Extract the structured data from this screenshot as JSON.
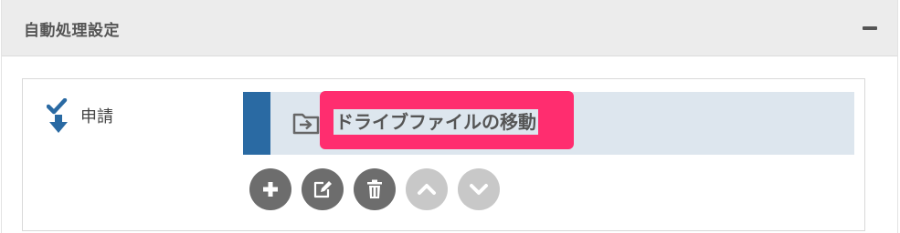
{
  "panel": {
    "title": "自動処理設定",
    "collapse_icon": "minus-icon"
  },
  "step": {
    "label": "申請",
    "icon": "check-down-arrow-icon",
    "icon_color": "#2a6aa3"
  },
  "process": {
    "label": "ドライブファイルの移動",
    "icon": "folder-move-icon",
    "bar_color": "#2a6aa3",
    "highlight_color": "#ff2d6f"
  },
  "actions": [
    {
      "name": "add",
      "icon": "plus-icon",
      "enabled": true
    },
    {
      "name": "edit",
      "icon": "edit-icon",
      "enabled": true
    },
    {
      "name": "delete",
      "icon": "trash-icon",
      "enabled": true
    },
    {
      "name": "move-up",
      "icon": "chevron-up-icon",
      "enabled": false
    },
    {
      "name": "move-down",
      "icon": "chevron-down-icon",
      "enabled": false
    }
  ]
}
